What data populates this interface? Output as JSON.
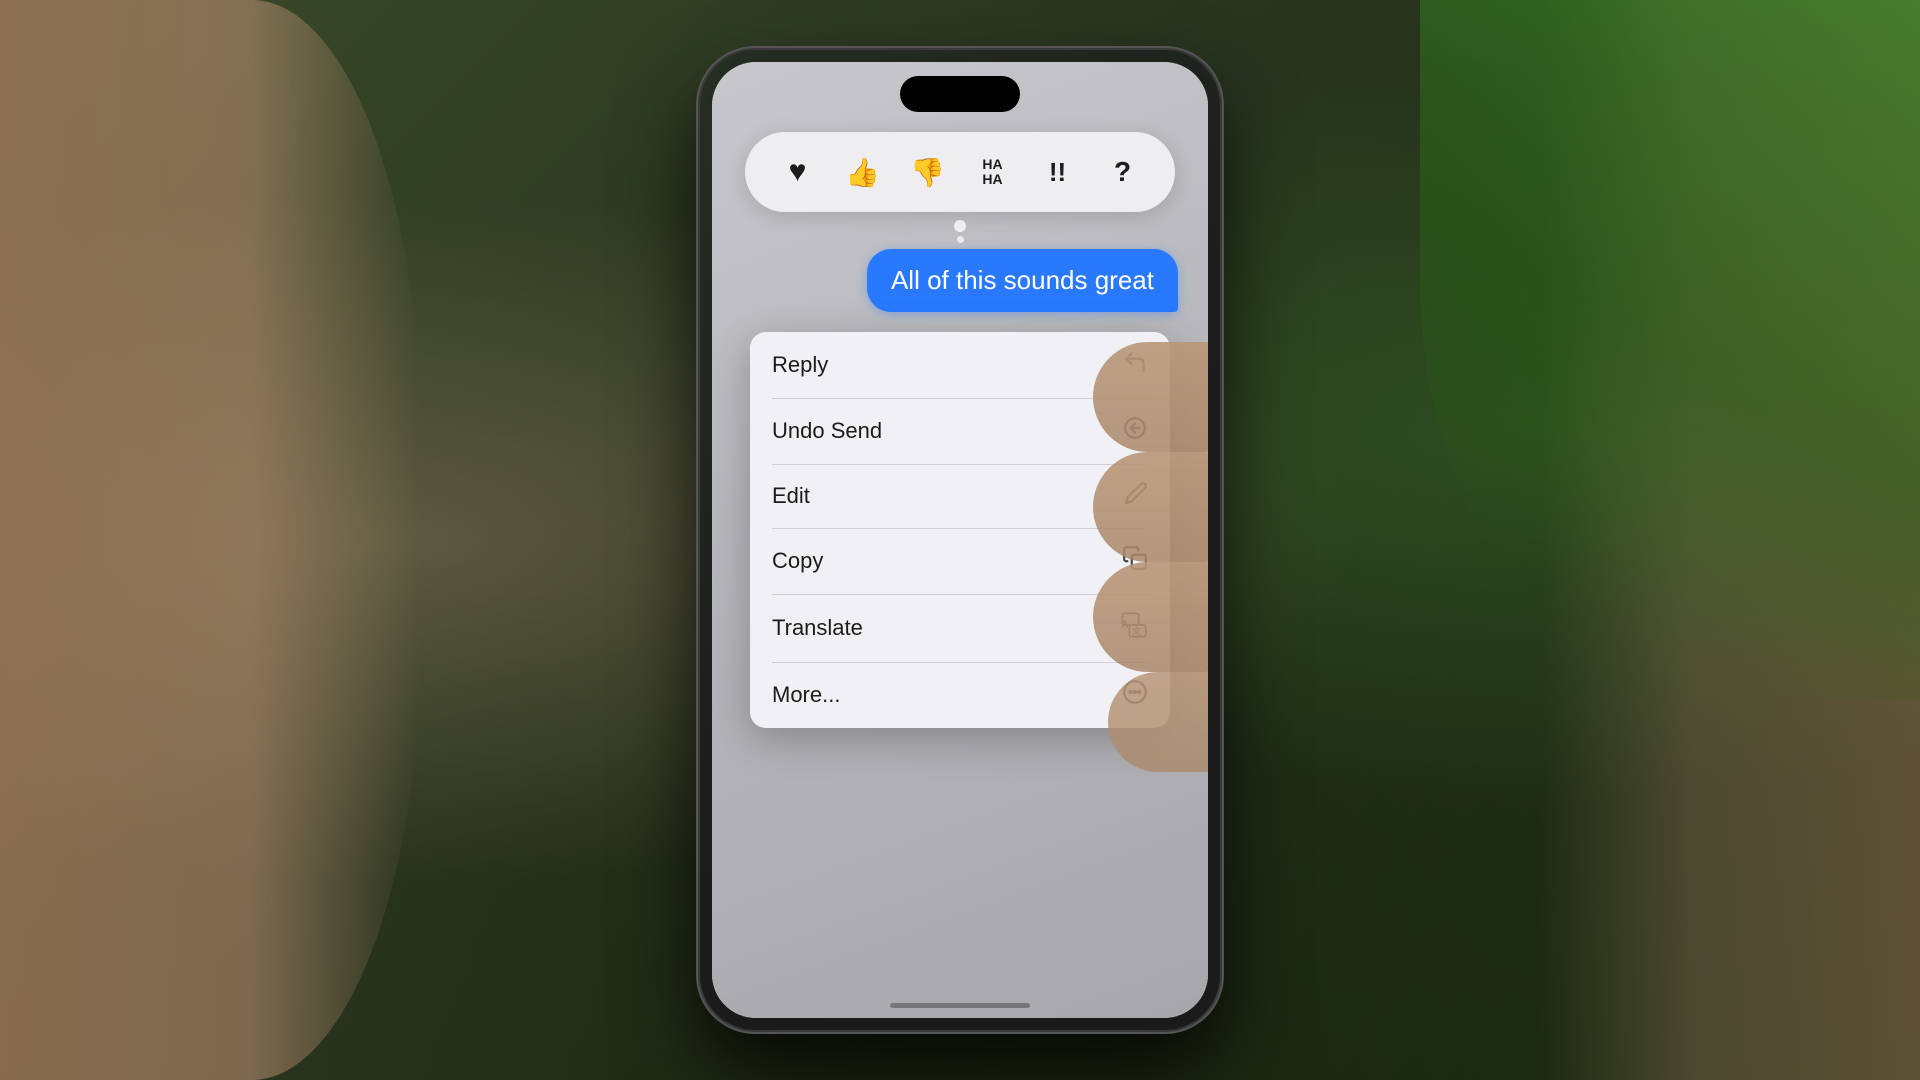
{
  "scene": {
    "app": "iMessage",
    "theme": "iOS context menu"
  },
  "reaction_bar": {
    "reactions": [
      {
        "id": "heart",
        "emoji": "♥",
        "label": "Heart"
      },
      {
        "id": "thumbs-up",
        "emoji": "👍",
        "label": "Thumbs Up"
      },
      {
        "id": "thumbs-down",
        "emoji": "👎",
        "label": "Thumbs Down"
      },
      {
        "id": "haha",
        "text": "HA\nHA",
        "label": "HaHa"
      },
      {
        "id": "exclamation",
        "text": "!!",
        "label": "Emphasis"
      },
      {
        "id": "question",
        "text": "?",
        "label": "Question"
      }
    ]
  },
  "message": {
    "text": "All of this sounds great",
    "sender": "self",
    "color": "#2979ff"
  },
  "context_menu": {
    "items": [
      {
        "id": "reply",
        "label": "Reply",
        "icon": "reply-icon"
      },
      {
        "id": "undo-send",
        "label": "Undo Send",
        "icon": "undo-icon"
      },
      {
        "id": "edit",
        "label": "Edit",
        "icon": "pencil-icon"
      },
      {
        "id": "copy",
        "label": "Copy",
        "icon": "copy-icon"
      },
      {
        "id": "translate",
        "label": "Translate",
        "icon": "translate-icon"
      },
      {
        "id": "more",
        "label": "More...",
        "icon": "more-icon"
      }
    ]
  },
  "home_indicator": {
    "visible": true
  }
}
